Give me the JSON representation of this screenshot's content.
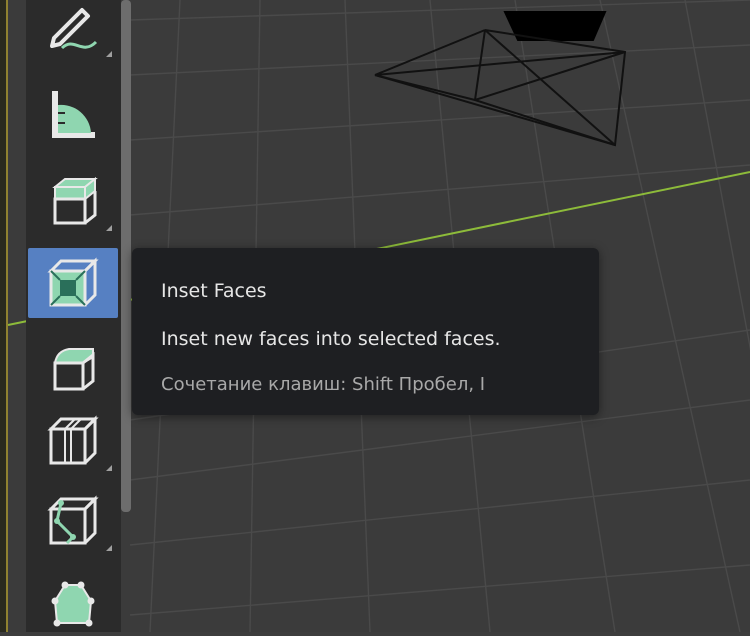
{
  "tooltip": {
    "title": "Inset Faces",
    "description": "Inset new faces into selected faces.",
    "shortcut": "Сочетание клавиш: Shift Пробел, I"
  },
  "toolbar": {
    "tools": [
      {
        "icon": "annotate-line-icon",
        "has_submenu": true,
        "active": false
      },
      {
        "icon": "measure-icon",
        "has_submenu": false,
        "active": false
      },
      {
        "icon": "extrude-region-icon",
        "has_submenu": true,
        "active": false
      },
      {
        "icon": "inset-faces-icon",
        "has_submenu": false,
        "active": true
      },
      {
        "icon": "bevel-icon",
        "has_submenu": false,
        "active": false
      },
      {
        "icon": "loop-cut-icon",
        "has_submenu": true,
        "active": false
      },
      {
        "icon": "knife-icon",
        "has_submenu": true,
        "active": false
      },
      {
        "icon": "poly-build-icon",
        "has_submenu": false,
        "active": false
      }
    ]
  },
  "colors": {
    "active_tool": "#5680c2",
    "tool_accent": "#8fd6b0",
    "tooltip_bg": "#1e1f22",
    "grid_axis": "#8dbb3a"
  }
}
